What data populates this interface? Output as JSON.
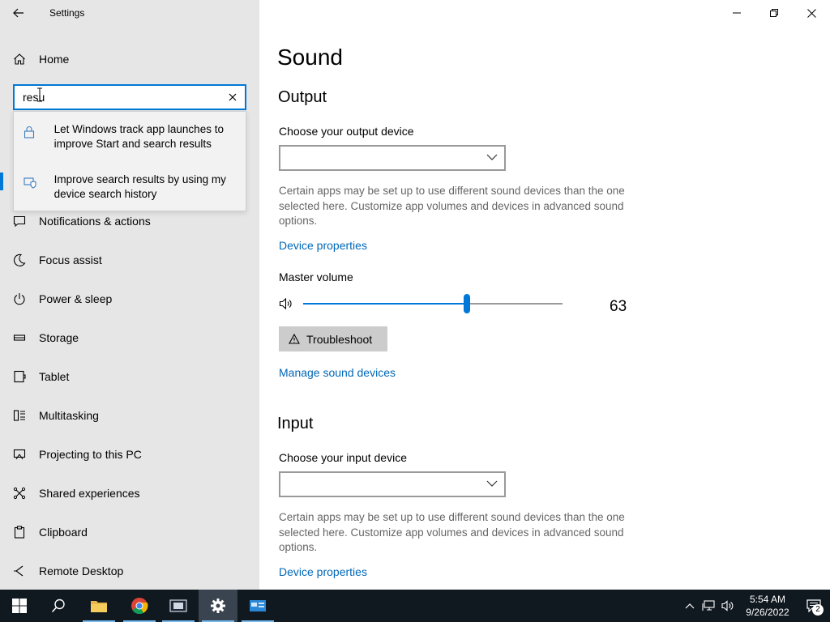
{
  "window": {
    "title": "Settings"
  },
  "sidebar": {
    "home_label": "Home",
    "search": {
      "value": "resu"
    },
    "suggestions": [
      {
        "text": "Let Windows track app launches to improve Start and search results",
        "icon": "lock-icon"
      },
      {
        "text": "Improve search results by using my device search history",
        "icon": "shield-icon"
      }
    ],
    "items": [
      {
        "label": "Notifications & actions",
        "icon": "notifications-icon"
      },
      {
        "label": "Focus assist",
        "icon": "moon-icon"
      },
      {
        "label": "Power & sleep",
        "icon": "power-icon"
      },
      {
        "label": "Storage",
        "icon": "storage-icon"
      },
      {
        "label": "Tablet",
        "icon": "tablet-icon"
      },
      {
        "label": "Multitasking",
        "icon": "multitasking-icon"
      },
      {
        "label": "Projecting to this PC",
        "icon": "projecting-icon"
      },
      {
        "label": "Shared experiences",
        "icon": "shared-icon"
      },
      {
        "label": "Clipboard",
        "icon": "clipboard-icon"
      },
      {
        "label": "Remote Desktop",
        "icon": "remote-desktop-icon"
      }
    ]
  },
  "main": {
    "title": "Sound",
    "output": {
      "heading": "Output",
      "device_label": "Choose your output device",
      "device_value": "",
      "description": "Certain apps may be set up to use different sound devices than the one selected here. Customize app volumes and devices in advanced sound options.",
      "device_properties": "Device properties",
      "master_volume_label": "Master volume",
      "volume": "63",
      "volume_fraction": 0.63,
      "troubleshoot": "Troubleshoot",
      "manage_devices": "Manage sound devices"
    },
    "input": {
      "heading": "Input",
      "device_label": "Choose your input device",
      "device_value": "",
      "description": "Certain apps may be set up to use different sound devices than the one selected here. Customize app volumes and devices in advanced sound options.",
      "device_properties": "Device properties"
    }
  },
  "taskbar": {
    "time": "5:54 AM",
    "date": "9/26/2022",
    "notification_count": "2",
    "apps": [
      "start-icon",
      "search-icon",
      "file-explorer-icon",
      "chrome-icon",
      "media-icon",
      "settings-icon",
      "app-icon"
    ]
  },
  "colors": {
    "accent": "#0078d7",
    "link": "#0067b8",
    "sidebar_bg": "#e6e6e6",
    "taskbar_bg": "#101820"
  }
}
